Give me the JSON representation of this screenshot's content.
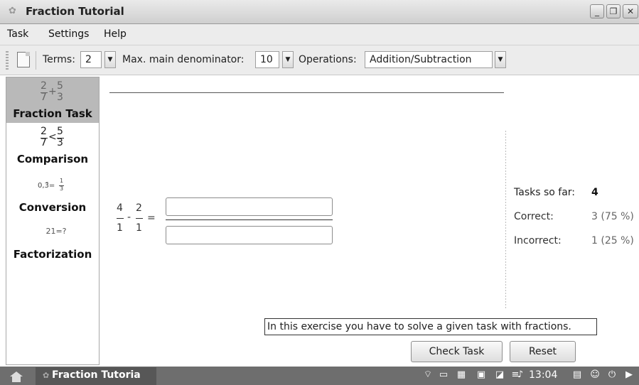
{
  "window": {
    "title": "Fraction Tutorial"
  },
  "menu": {
    "items": [
      "Task",
      "Settings",
      "Help"
    ]
  },
  "toolbar": {
    "terms_label": "Terms:",
    "terms_value": "2",
    "max_denominator_label": "Max. main denominator:",
    "max_denominator_value": "10",
    "operations_label": "Operations:",
    "operations_value": "Addition/Subtraction"
  },
  "sidebar": {
    "items": [
      {
        "label": "Fraction Task",
        "icon_text": "2/7 + 5/3",
        "active": true
      },
      {
        "label": "Comparison",
        "icon_text": "2/7 < 5/3",
        "active": false
      },
      {
        "label": "Conversion",
        "icon_text": "0,3̄ = 1/3",
        "active": false
      },
      {
        "label": "Factorization",
        "icon_text": "21=?",
        "active": false
      }
    ],
    "icons": {
      "task_n1": "2",
      "task_d1": "7",
      "task_op": "+",
      "task_n2": "5",
      "task_d2": "3",
      "cmp_n1": "2",
      "cmp_d1": "7",
      "cmp_op": "<",
      "cmp_n2": "5",
      "cmp_d2": "3",
      "conv_left": "0,3̄=",
      "conv_n": "1",
      "conv_d": "3",
      "fact": "21=?"
    }
  },
  "task": {
    "num1": "4",
    "den1": "1",
    "operator": "-",
    "num2": "2",
    "den2": "1",
    "equals": "=",
    "answer_numerator": "",
    "answer_denominator": ""
  },
  "stats": {
    "tasks_label": "Tasks so far:",
    "tasks_value": "4",
    "correct_label": "Correct:",
    "correct_value": "3 (75 %)",
    "incorrect_label": "Incorrect:",
    "incorrect_value": "1 (25 %)"
  },
  "hint": "In this exercise you have to solve a given task with fractions.",
  "buttons": {
    "check": "Check Task",
    "reset": "Reset"
  },
  "taskbar": {
    "task_label": "Fraction Tutoria",
    "clock": "13:04"
  }
}
